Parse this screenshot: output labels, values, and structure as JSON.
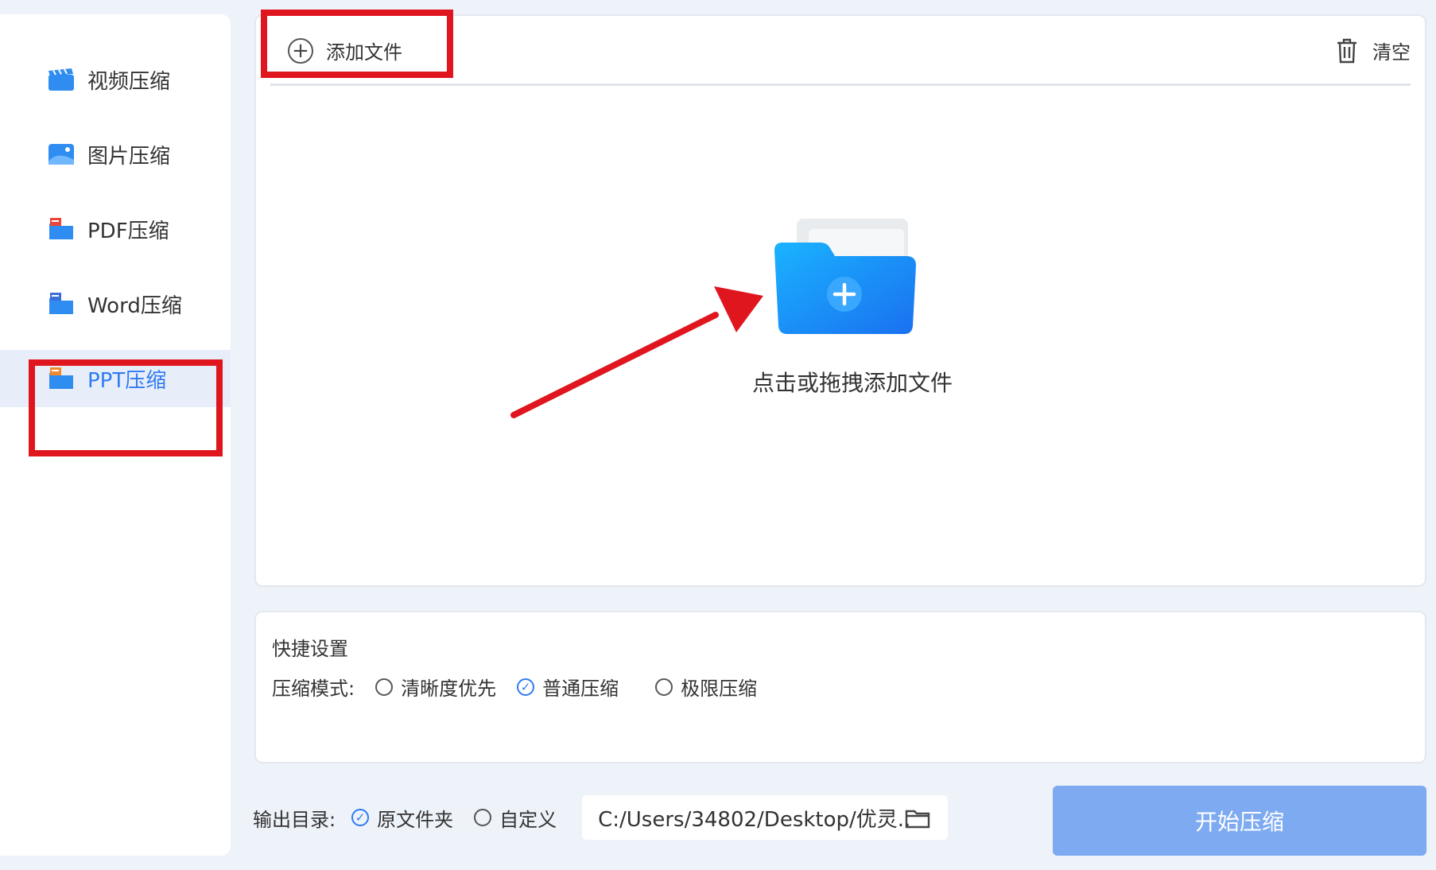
{
  "sidebar": {
    "items": [
      {
        "label": "视频压缩",
        "icon": "video-clapper-icon"
      },
      {
        "label": "图片压缩",
        "icon": "image-icon"
      },
      {
        "label": "PDF压缩",
        "icon": "pdf-folder-icon"
      },
      {
        "label": "Word压缩",
        "icon": "word-folder-icon"
      },
      {
        "label": "PPT压缩",
        "icon": "ppt-folder-icon",
        "active": true
      }
    ]
  },
  "file_panel": {
    "add_file_label": "添加文件",
    "clear_label": "清空",
    "drop_text": "点击或拖拽添加文件"
  },
  "settings": {
    "title": "快捷设置",
    "mode_label": "压缩模式:",
    "modes": [
      {
        "label": "清晰度优先",
        "checked": false
      },
      {
        "label": "普通压缩",
        "checked": true
      },
      {
        "label": "极限压缩",
        "checked": false
      }
    ]
  },
  "output": {
    "label": "输出目录:",
    "options": [
      {
        "label": "原文件夹",
        "checked": true
      },
      {
        "label": "自定义",
        "checked": false
      }
    ],
    "path": "C:/Users/34802/Desktop/优灵.."
  },
  "start_button_label": "开始压缩",
  "colors": {
    "accent": "#2f7bf2",
    "highlight_red": "#e0161f",
    "start_button": "#7daaf1",
    "background": "#eef2f9"
  }
}
